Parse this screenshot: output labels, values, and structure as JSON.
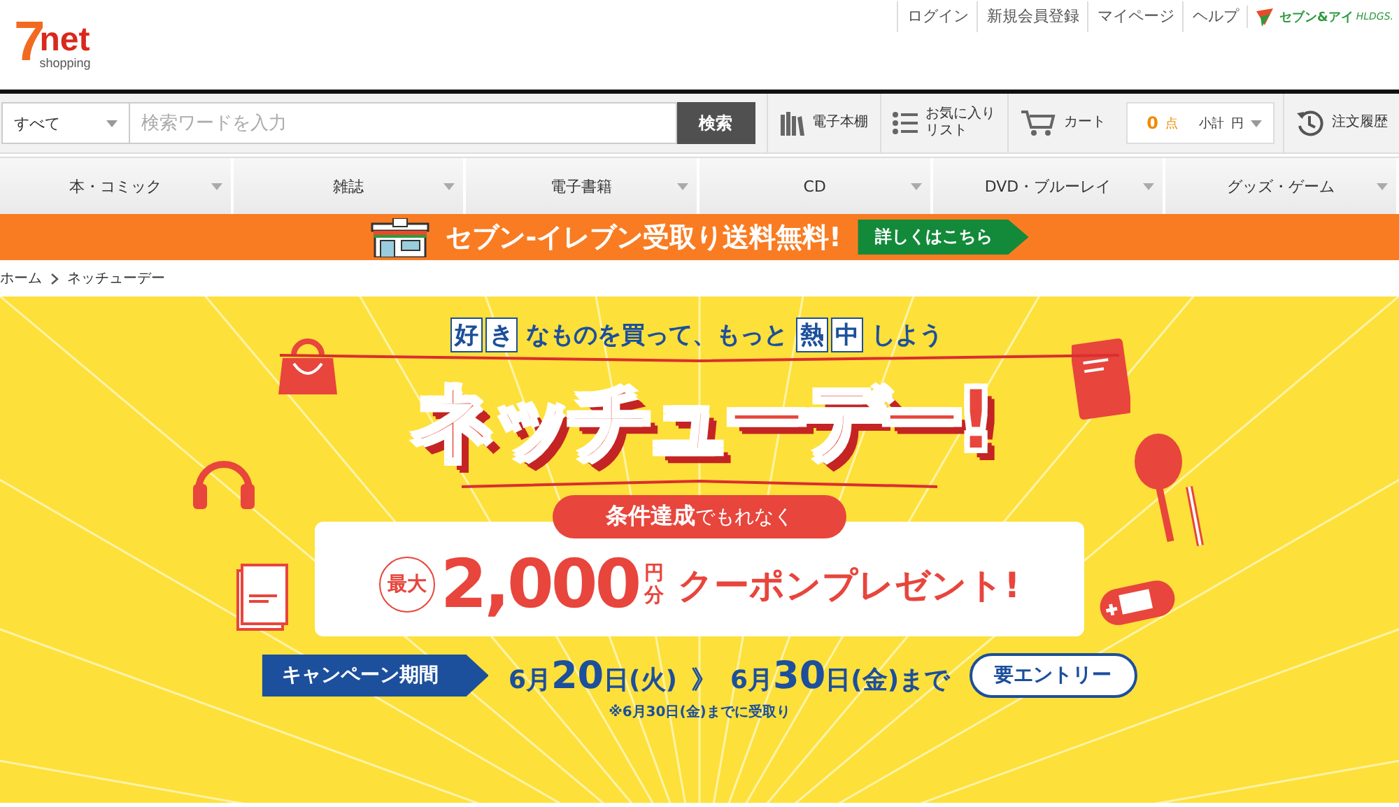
{
  "header": {
    "logo": {
      "mark": "7",
      "word": "net",
      "sub": "shopping"
    },
    "top_links": [
      "ログイン",
      "新規会員登録",
      "マイページ",
      "ヘルプ"
    ],
    "group_logo": {
      "name": "セブン&アイ",
      "suffix": "HLDGS."
    }
  },
  "search": {
    "category": "すべて",
    "placeholder": "検索ワードを入力",
    "button": "検索"
  },
  "toolbar": [
    {
      "kind": "shelf",
      "lines": [
        "電子本棚"
      ]
    },
    {
      "kind": "list",
      "lines": [
        "お気に入り",
        "リスト"
      ]
    },
    {
      "kind": "cart",
      "lines": [
        "カート"
      ]
    },
    {
      "kind": "summary",
      "count": "0",
      "count_unit": "点",
      "subtotal_label": "小計",
      "currency": "円"
    },
    {
      "kind": "history",
      "lines": [
        "注文履歴"
      ]
    }
  ],
  "nav_tabs": [
    "本・コミック",
    "雑誌",
    "電子書籍",
    "CD",
    "DVD・ブルーレイ",
    "グッズ・ゲーム"
  ],
  "promo_banner": {
    "text": "セブン-イレブン受取り送料無料!",
    "button": "詳しくはこちら"
  },
  "breadcrumb": [
    "ホーム",
    "ネッチューデー"
  ],
  "hero": {
    "tagline": [
      {
        "text": "好",
        "boxed": true
      },
      {
        "text": "き",
        "boxed": true
      },
      {
        "text": "なものを買って、もっと",
        "boxed": false
      },
      {
        "text": "熱",
        "boxed": true
      },
      {
        "text": "中",
        "boxed": true
      },
      {
        "text": "しよう",
        "boxed": false
      }
    ],
    "title": "ネッチューデー!",
    "ribbon": "**条件達成**でもれなく",
    "coupon": {
      "badge": "最大",
      "amount": "2,000",
      "unit_top": "円",
      "unit_bottom": "分",
      "text": "クーポンプレゼント!"
    },
    "period_label": "キャンペーン期間",
    "period": [
      {
        "text": "6月",
        "kind": "small"
      },
      {
        "text": "20",
        "kind": "big"
      },
      {
        "text": "日(火)",
        "kind": "small"
      },
      {
        "text": "》",
        "kind": "sep"
      },
      {
        "text": "6月",
        "kind": "small"
      },
      {
        "text": "30",
        "kind": "big"
      },
      {
        "text": "日(金)",
        "kind": "small"
      },
      {
        "text": "まで",
        "kind": "small"
      }
    ],
    "entry_button": "要エントリー",
    "note": "※6月30日(金)までに受取り"
  }
}
